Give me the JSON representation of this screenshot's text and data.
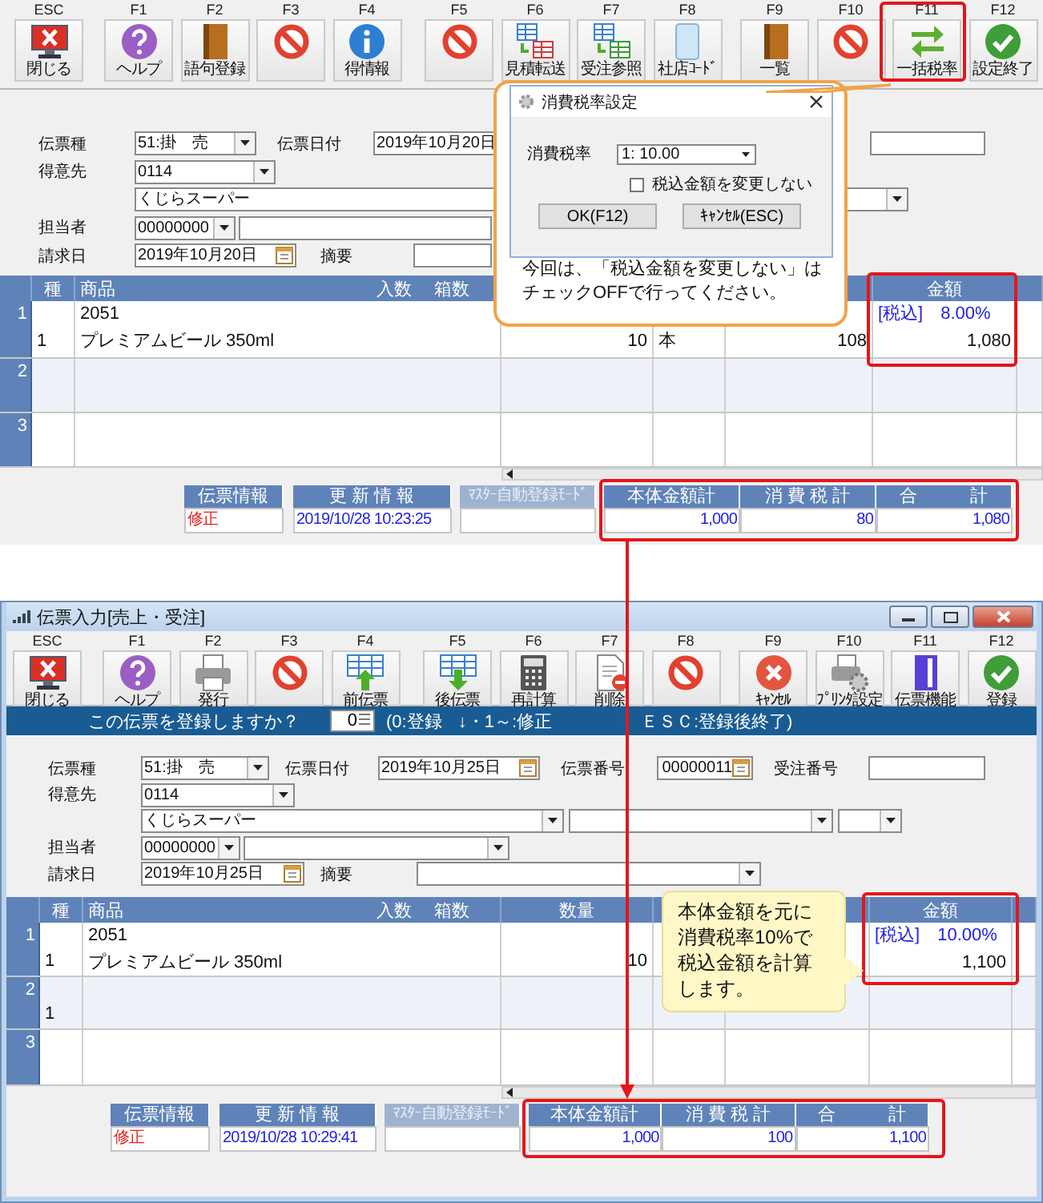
{
  "upper_screen": {
    "toolbar": [
      {
        "key": "ESC",
        "label": "閉じる",
        "kind": "close"
      },
      {
        "key": "F1",
        "label": "ヘルプ",
        "kind": "help"
      },
      {
        "key": "F2",
        "label": "語句登録",
        "kind": "book"
      },
      {
        "key": "F3",
        "kind": "prohibit"
      },
      {
        "key": "F4",
        "label": "得情報",
        "kind": "info"
      },
      {
        "key": "F5",
        "kind": "prohibit"
      },
      {
        "key": "F6",
        "label": "見積転送",
        "kind": "sheets_red"
      },
      {
        "key": "F7",
        "label": "受注参照",
        "kind": "sheets_green"
      },
      {
        "key": "F8",
        "label": "社店ｺｰﾄﾞ",
        "kind": "card"
      },
      {
        "key": "F9",
        "label": "一覧",
        "kind": "book"
      },
      {
        "key": "F10",
        "kind": "prohibit"
      },
      {
        "key": "F11",
        "label": "一括税率",
        "kind": "switch"
      },
      {
        "key": "F12",
        "label": "設定終了",
        "kind": "check"
      }
    ],
    "form": {
      "slip_type": {
        "label": "伝票種",
        "value": "51:掛　売"
      },
      "slip_date": {
        "label": "伝票日付",
        "value": "2019年10月20日"
      },
      "customer": {
        "label": "得意先",
        "code": "0114",
        "name": "くじらスーパー"
      },
      "staff": {
        "label": "担当者",
        "code": "00000000"
      },
      "billing_date": {
        "label": "請求日",
        "value": "2019年10月20日"
      },
      "memo": {
        "label": "摘要"
      }
    },
    "grid": {
      "header": {
        "category": "種",
        "product": "商品",
        "per_case": "入数",
        "cases": "箱数",
        "amount": "金額"
      },
      "rows": [
        {
          "number": "1",
          "code": "2051",
          "category": "1",
          "product": "プレミアムビール 350ml",
          "quantity": "10",
          "unit": "本",
          "price": "108",
          "tax": "[税込]　8.00%",
          "amount": "1,080"
        },
        {
          "number": "2"
        },
        {
          "number": "3"
        }
      ]
    },
    "footer": {
      "slip_info": {
        "label": "伝票情報",
        "value": "修正"
      },
      "update_info": {
        "label": "更 新 情 報",
        "value": "2019/10/28 10:23:25"
      },
      "master_mode": {
        "label": "ﾏｽﾀｰ自動登録ﾓｰﾄﾞ"
      },
      "totals": [
        {
          "label": "本体金額計",
          "value": "1,000"
        },
        {
          "label": "消 費 税 計",
          "value": "80"
        },
        {
          "label": "合　　　計",
          "value": "1,080"
        }
      ]
    }
  },
  "tax_dialog_callout": {
    "dialog": {
      "title": "消費税率設定",
      "rate_label": "消費税率",
      "rate_value": "1: 10.00",
      "keep_tax_included": {
        "label": "税込金額を変更しない",
        "checked": false
      },
      "buttons": [
        "OK(F12)",
        "ｷｬﾝｾﾙ(ESC)"
      ]
    },
    "note": [
      "今回は、「税込金額を変更しない」は",
      "チェックOFFで行ってください。"
    ]
  },
  "lower_screen": {
    "window": {
      "title": "伝票入力[売上・受注]"
    },
    "toolbar": [
      {
        "key": "ESC",
        "label": "閉じる",
        "kind": "close"
      },
      {
        "key": "F1",
        "label": "ヘルプ",
        "kind": "help"
      },
      {
        "key": "F2",
        "label": "発行",
        "kind": "printer"
      },
      {
        "key": "F3",
        "kind": "prohibit"
      },
      {
        "key": "F4",
        "label": "前伝票",
        "kind": "prev"
      },
      {
        "key": "F5",
        "label": "後伝票",
        "kind": "next"
      },
      {
        "key": "F6",
        "label": "再計算",
        "kind": "calc"
      },
      {
        "key": "F7",
        "label": "削除",
        "kind": "delete"
      },
      {
        "key": "F8",
        "kind": "prohibit"
      },
      {
        "key": "F9",
        "label": "ｷｬﾝｾﾙ",
        "kind": "cancel"
      },
      {
        "key": "F10",
        "label": "ﾌﾟﾘﾝﾀ設定",
        "kind": "printer_gear"
      },
      {
        "key": "F11",
        "label": "伝票機能",
        "kind": "binder"
      },
      {
        "key": "F12",
        "label": "登録",
        "kind": "check"
      }
    ],
    "prompt": {
      "question": "この伝票を登録しますか？",
      "value": "0",
      "hint": [
        "(0:登録",
        "↓・1～:修正",
        "ＥＳＣ:登録後終了)"
      ]
    },
    "form": {
      "slip_type": {
        "label": "伝票種",
        "value": "51:掛　売"
      },
      "slip_date": {
        "label": "伝票日付",
        "value": "2019年10月25日"
      },
      "slip_number": {
        "label": "伝票番号",
        "value": "00000011"
      },
      "order_number": {
        "label": "受注番号"
      },
      "customer": {
        "label": "得意先",
        "code": "0114",
        "name": "くじらスーパー"
      },
      "staff": {
        "label": "担当者",
        "code": "00000000"
      },
      "billing_date": {
        "label": "請求日",
        "value": "2019年10月25日"
      },
      "memo": {
        "label": "摘要"
      }
    },
    "grid": {
      "header": {
        "category": "種",
        "product": "商品",
        "per_case": "入数",
        "cases": "箱数",
        "quantity": "数量",
        "amount": "金額"
      },
      "rows": [
        {
          "number": "1",
          "code": "2051",
          "category": "1",
          "product": "プレミアムビール 350ml",
          "quantity": "10",
          "tax": "[税込]　10.00%",
          "amount": "1,100"
        },
        {
          "number": "2",
          "category": "1"
        },
        {
          "number": "3"
        }
      ]
    },
    "footer": {
      "slip_info": {
        "label": "伝票情報",
        "value": "修正"
      },
      "update_info": {
        "label": "更 新 情 報",
        "value": "2019/10/28 10:29:41"
      },
      "master_mode": {
        "label": "ﾏｽﾀｰ自動登録ﾓｰﾄﾞ"
      },
      "totals": [
        {
          "label": "本体金額計",
          "value": "1,000"
        },
        {
          "label": "消 費 税 計",
          "value": "100"
        },
        {
          "label": "合　　　計",
          "value": "1,100"
        }
      ]
    }
  },
  "explanation_callout": {
    "lines": [
      "本体金額を元に",
      "消費税率10%で",
      "税込金額を計算",
      "します。"
    ]
  }
}
